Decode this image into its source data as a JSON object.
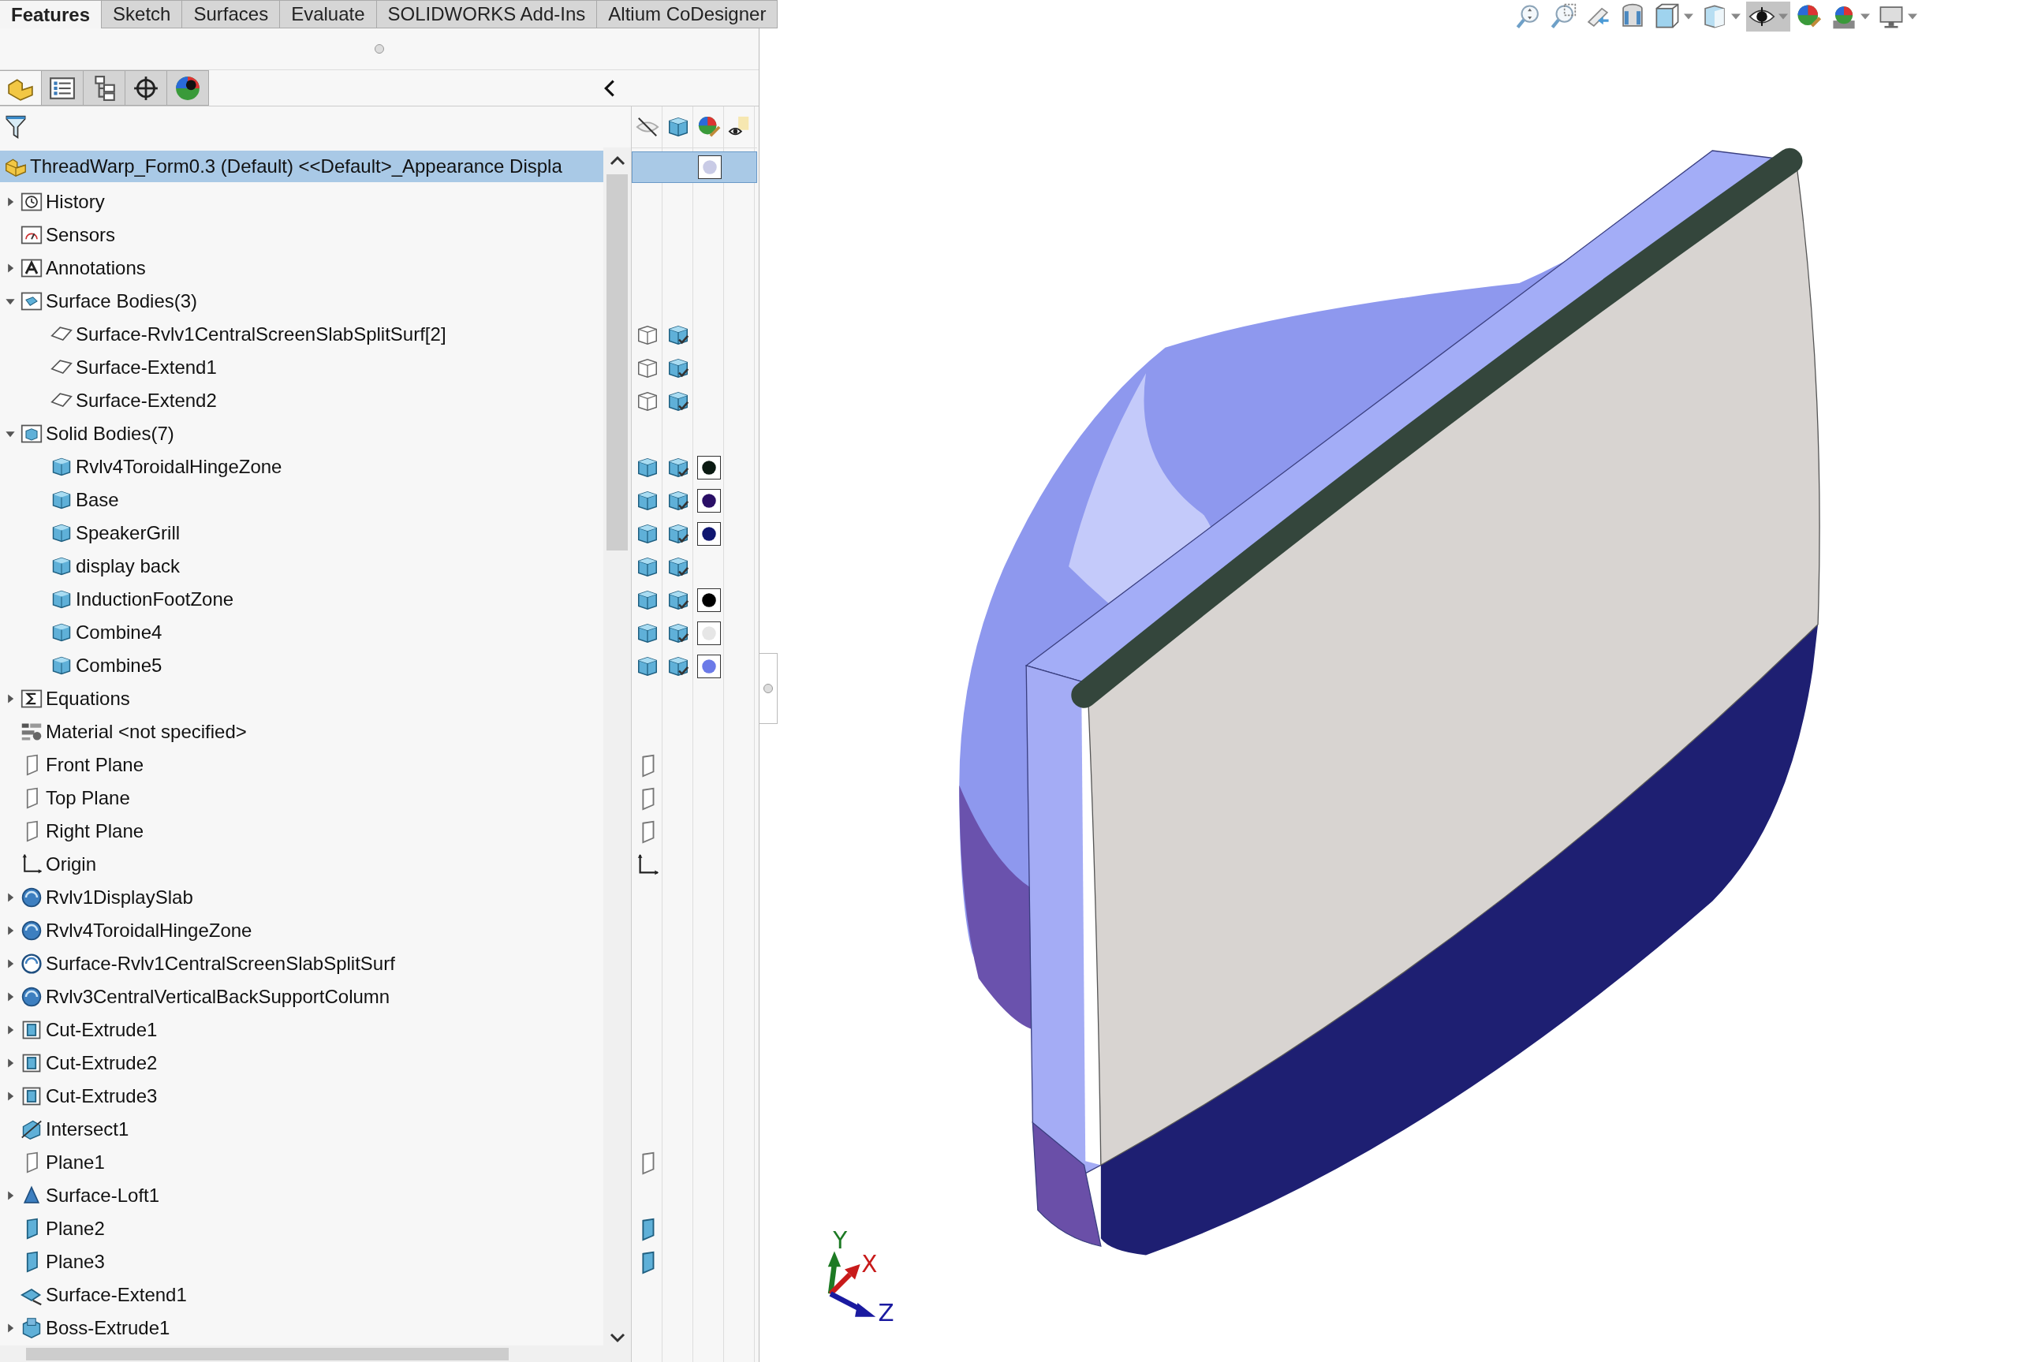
{
  "command_tabs": [
    {
      "label": "Features",
      "selected": true
    },
    {
      "label": "Sketch",
      "selected": false
    },
    {
      "label": "Surfaces",
      "selected": false
    },
    {
      "label": "Evaluate",
      "selected": false
    },
    {
      "label": "SOLIDWORKS Add-Ins",
      "selected": false
    },
    {
      "label": "Altium CoDesigner",
      "selected": false
    }
  ],
  "panel_tabs": [
    {
      "kind": "feature-tree",
      "selected": true
    },
    {
      "kind": "property",
      "selected": false
    },
    {
      "kind": "configuration",
      "selected": false
    },
    {
      "kind": "dimxpert",
      "selected": false
    },
    {
      "kind": "display",
      "selected": false
    }
  ],
  "tree": {
    "root": {
      "label": "ThreadWarp_Form0.3 (Default) <<Default>_Appearance Displa",
      "kind": "part",
      "selected": true,
      "display_pane": {
        "color": "#c9cbe6"
      }
    },
    "items": [
      {
        "label": "History",
        "kind": "history",
        "expanded": false
      },
      {
        "label": "Sensors",
        "kind": "sensors"
      },
      {
        "label": "Annotations",
        "kind": "annotations",
        "expanded": false
      },
      {
        "label": "Surface Bodies(3)",
        "kind": "surface-bodies",
        "expanded": true,
        "children": [
          {
            "label": "Surface-Rvlv1CentralScreenSlabSplitSurf[2]",
            "kind": "surface-body",
            "display_pane": {
              "visibility": {
                "kind": "wireframe"
              },
              "display_mode": true
            }
          },
          {
            "label": "Surface-Extend1",
            "kind": "surface-body",
            "display_pane": {
              "visibility": {
                "kind": "wireframe"
              },
              "display_mode": true
            }
          },
          {
            "label": "Surface-Extend2",
            "kind": "surface-body",
            "display_pane": {
              "visibility": {
                "kind": "wireframe"
              },
              "display_mode": true
            }
          }
        ]
      },
      {
        "label": "Solid Bodies(7)",
        "kind": "solid-bodies",
        "expanded": true,
        "children": [
          {
            "label": "Rvlv4ToroidalHingeZone",
            "kind": "solid-body",
            "display_pane": {
              "visibility": {
                "kind": "shaded"
              },
              "display_mode": true,
              "color": "#0b1a12"
            }
          },
          {
            "label": "Base",
            "kind": "solid-body",
            "display_pane": {
              "visibility": {
                "kind": "shaded"
              },
              "display_mode": true,
              "color": "#2a0f66"
            }
          },
          {
            "label": "SpeakerGrill",
            "kind": "solid-body",
            "display_pane": {
              "visibility": {
                "kind": "shaded"
              },
              "display_mode": true,
              "color": "#0f1670"
            }
          },
          {
            "label": "display back",
            "kind": "solid-body",
            "display_pane": {
              "visibility": {
                "kind": "shaded"
              },
              "display_mode": true
            }
          },
          {
            "label": "InductionFootZone",
            "kind": "solid-body",
            "display_pane": {
              "visibility": {
                "kind": "shaded"
              },
              "display_mode": true,
              "color": "#000000"
            }
          },
          {
            "label": "Combine4",
            "kind": "solid-body",
            "display_pane": {
              "visibility": {
                "kind": "shaded"
              },
              "display_mode": true,
              "color": "#e6e6e6"
            }
          },
          {
            "label": "Combine5",
            "kind": "solid-body",
            "display_pane": {
              "visibility": {
                "kind": "shaded"
              },
              "display_mode": true,
              "color": "#6b7ae8"
            }
          }
        ]
      },
      {
        "label": "Equations",
        "kind": "equations",
        "expanded": false
      },
      {
        "label": "Material <not specified>",
        "kind": "material"
      },
      {
        "label": "Front Plane",
        "kind": "plane",
        "display_pane": {
          "visibility": {
            "kind": "plane"
          }
        }
      },
      {
        "label": "Top Plane",
        "kind": "plane",
        "display_pane": {
          "visibility": {
            "kind": "plane"
          }
        }
      },
      {
        "label": "Right Plane",
        "kind": "plane",
        "display_pane": {
          "visibility": {
            "kind": "plane"
          }
        }
      },
      {
        "label": "Origin",
        "kind": "origin",
        "display_pane": {
          "visibility": {
            "kind": "origin"
          }
        }
      },
      {
        "label": "Rvlv1DisplaySlab",
        "kind": "revolve",
        "expanded": false
      },
      {
        "label": "Rvlv4ToroidalHingeZone",
        "kind": "revolve",
        "expanded": false
      },
      {
        "label": "Surface-Rvlv1CentralScreenSlabSplitSurf",
        "kind": "surface-revolve",
        "expanded": false
      },
      {
        "label": "Rvlv3CentralVerticalBackSupportColumn",
        "kind": "revolve",
        "expanded": false
      },
      {
        "label": "Cut-Extrude1",
        "kind": "cut-extrude",
        "expanded": false
      },
      {
        "label": "Cut-Extrude2",
        "kind": "cut-extrude",
        "expanded": false
      },
      {
        "label": "Cut-Extrude3",
        "kind": "cut-extrude",
        "expanded": false
      },
      {
        "label": "Intersect1",
        "kind": "intersect"
      },
      {
        "label": "Plane1",
        "kind": "plane",
        "display_pane": {
          "visibility": {
            "kind": "plane"
          }
        }
      },
      {
        "label": "Surface-Loft1",
        "kind": "surface-loft",
        "expanded": false
      },
      {
        "label": "Plane2",
        "kind": "plane-shaded",
        "display_pane": {
          "visibility": {
            "kind": "plane-shaded"
          }
        }
      },
      {
        "label": "Plane3",
        "kind": "plane-shaded",
        "display_pane": {
          "visibility": {
            "kind": "plane-shaded"
          }
        }
      },
      {
        "label": "Surface-Extend1",
        "kind": "surface-extend"
      },
      {
        "label": "Boss-Extrude1",
        "kind": "boss-extrude",
        "expanded": false
      }
    ]
  },
  "view_toolbar": [
    {
      "kind": "zoom-to-fit",
      "dropdown": false,
      "selected": false
    },
    {
      "kind": "zoom-area",
      "dropdown": false,
      "selected": false
    },
    {
      "kind": "previous-view",
      "dropdown": false,
      "selected": false
    },
    {
      "kind": "section-view",
      "dropdown": false,
      "selected": false
    },
    {
      "kind": "view-orientation",
      "dropdown": true,
      "selected": false
    },
    {
      "kind": "display-style",
      "dropdown": true,
      "selected": false
    },
    {
      "kind": "hide-show",
      "dropdown": true,
      "selected": true
    },
    {
      "kind": "edit-appearance",
      "dropdown": false,
      "selected": false
    },
    {
      "kind": "scene",
      "dropdown": true,
      "selected": false
    },
    {
      "kind": "view-settings",
      "dropdown": true,
      "selected": false
    }
  ],
  "triad": {
    "axes": [
      {
        "label": "Y"
      },
      {
        "label": "X"
      },
      {
        "label": "Z"
      }
    ]
  }
}
